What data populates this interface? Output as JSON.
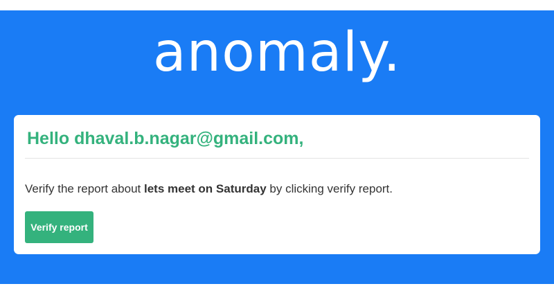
{
  "brand": {
    "logo_text": "anomaly.",
    "background_color": "#1a7cf5"
  },
  "card": {
    "greeting": "Hello dhaval.b.nagar@gmail.com,",
    "message_before": "Verify the report about ",
    "message_subject": "lets meet on Saturday",
    "message_after": " by clicking verify report.",
    "button_label": "Verify report",
    "accent_color": "#34b27d"
  }
}
